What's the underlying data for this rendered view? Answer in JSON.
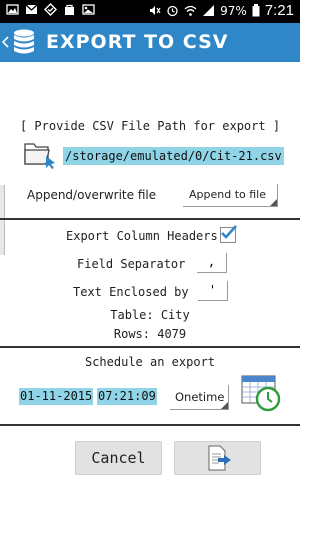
{
  "status_bar": {
    "battery": "97%",
    "time": "7:21"
  },
  "app_bar": {
    "title": "EXPORT TO CSV"
  },
  "export_path": {
    "prompt": "[ Provide CSV File Path for export ]",
    "value": "/storage/emulated/0/Cit-21.csv"
  },
  "write_mode": {
    "label": "Append/overwrite file",
    "selected": "Append to file"
  },
  "options": {
    "export_headers_label": "Export Column Headers",
    "export_headers_checked": true,
    "field_separator_label": "Field Separator",
    "field_separator_value": ",",
    "text_enclosed_label": "Text Enclosed by",
    "text_enclosed_value": "'",
    "table_line": "Table: City",
    "rows_line": "Rows: 4079"
  },
  "schedule": {
    "heading": "Schedule an export",
    "date": "01-11-2015",
    "time": "07:21:09",
    "frequency": "Onetime"
  },
  "actions": {
    "cancel_label": "Cancel"
  },
  "colors": {
    "app_bar": "#2f87c7",
    "highlight": "#90d4e8",
    "check": "#2f87c7"
  }
}
